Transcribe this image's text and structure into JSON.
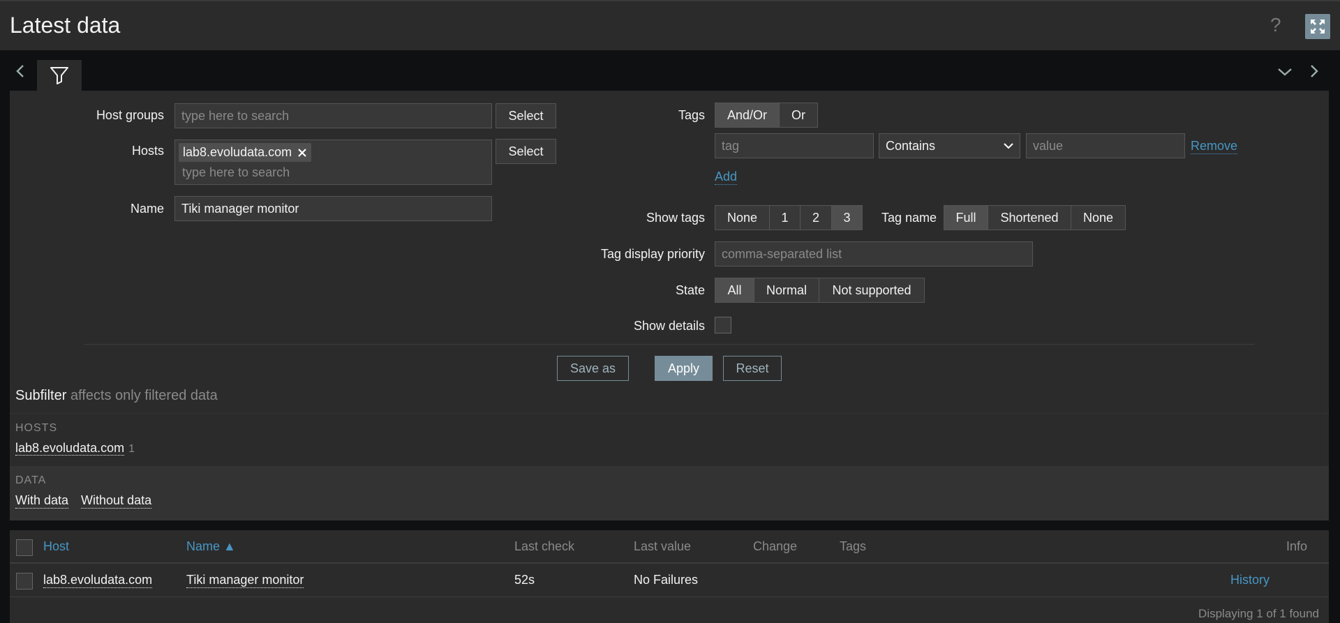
{
  "header": {
    "title": "Latest data",
    "help_icon": "?"
  },
  "filter": {
    "host_groups_label": "Host groups",
    "host_groups_placeholder": "type here to search",
    "hosts_label": "Hosts",
    "hosts_selected": "lab8.evoludata.com",
    "hosts_placeholder": "type here to search",
    "select_label": "Select",
    "name_label": "Name",
    "name_value": "Tiki manager monitor",
    "tags_label": "Tags",
    "tags_operator": [
      "And/Or",
      "Or"
    ],
    "tag_placeholder": "tag",
    "tag_operator_value": "Contains",
    "value_placeholder": "value",
    "remove_label": "Remove",
    "add_label": "Add",
    "show_tags_label": "Show tags",
    "show_tags_options": [
      "None",
      "1",
      "2",
      "3"
    ],
    "tag_name_label": "Tag name",
    "tag_name_options": [
      "Full",
      "Shortened",
      "None"
    ],
    "tag_priority_label": "Tag display priority",
    "tag_priority_placeholder": "comma-separated list",
    "state_label": "State",
    "state_options": [
      "All",
      "Normal",
      "Not supported"
    ],
    "show_details_label": "Show details",
    "save_as_label": "Save as",
    "apply_label": "Apply",
    "reset_label": "Reset"
  },
  "subfilter": {
    "title": "Subfilter",
    "subtitle": "affects only filtered data",
    "hosts_heading": "HOSTS",
    "hosts_item": "lab8.evoludata.com",
    "hosts_item_count": "1",
    "data_heading": "DATA",
    "data_items": [
      "With data",
      "Without data"
    ]
  },
  "table": {
    "headers": {
      "host": "Host",
      "name": "Name ▲",
      "last_check": "Last check",
      "last_value": "Last value",
      "change": "Change",
      "tags": "Tags",
      "info": "Info"
    },
    "rows": [
      {
        "host": "lab8.evoludata.com",
        "name": "Tiki manager monitor",
        "last_check": "52s",
        "last_value": "No Failures",
        "change": "",
        "tags": "",
        "info": "History"
      }
    ],
    "footer": "Displaying 1 of 1 found"
  },
  "colors": {
    "accent": "#768d99",
    "link": "#4796c4",
    "panel": "#2b2b2b",
    "background": "#0e1012"
  }
}
